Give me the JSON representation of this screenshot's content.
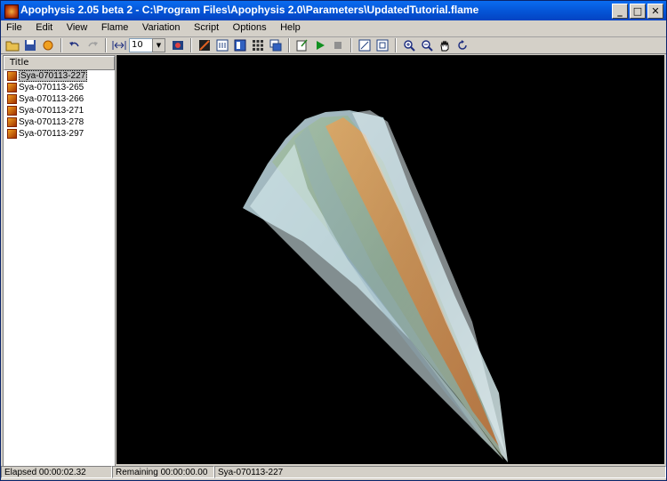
{
  "window": {
    "title": "Apophysis 2.05 beta 2 - C:\\Program Files\\Apophysis 2.0\\Parameters\\UpdatedTutorial.flame"
  },
  "window_buttons": {
    "minimize": "_",
    "maximize": "□",
    "close": "✕"
  },
  "menu": [
    "File",
    "Edit",
    "View",
    "Flame",
    "Variation",
    "Script",
    "Options",
    "Help"
  ],
  "toolbar": {
    "density_value": "10"
  },
  "sidebar": {
    "header": "Title",
    "items": [
      "Sya-070113-227",
      "Sya-070113-265",
      "Sya-070113-266",
      "Sya-070113-271",
      "Sya-070113-278",
      "Sya-070113-297"
    ],
    "selected_index": 0
  },
  "status": {
    "elapsed": "Elapsed 00:00:02.32",
    "remaining": "Remaining 00:00:00.00",
    "current": "Sya-070113-227"
  },
  "colors": {
    "titlebar": "#0556d8",
    "canvas_bg": "#000000",
    "selection": "#c0c0c0"
  }
}
